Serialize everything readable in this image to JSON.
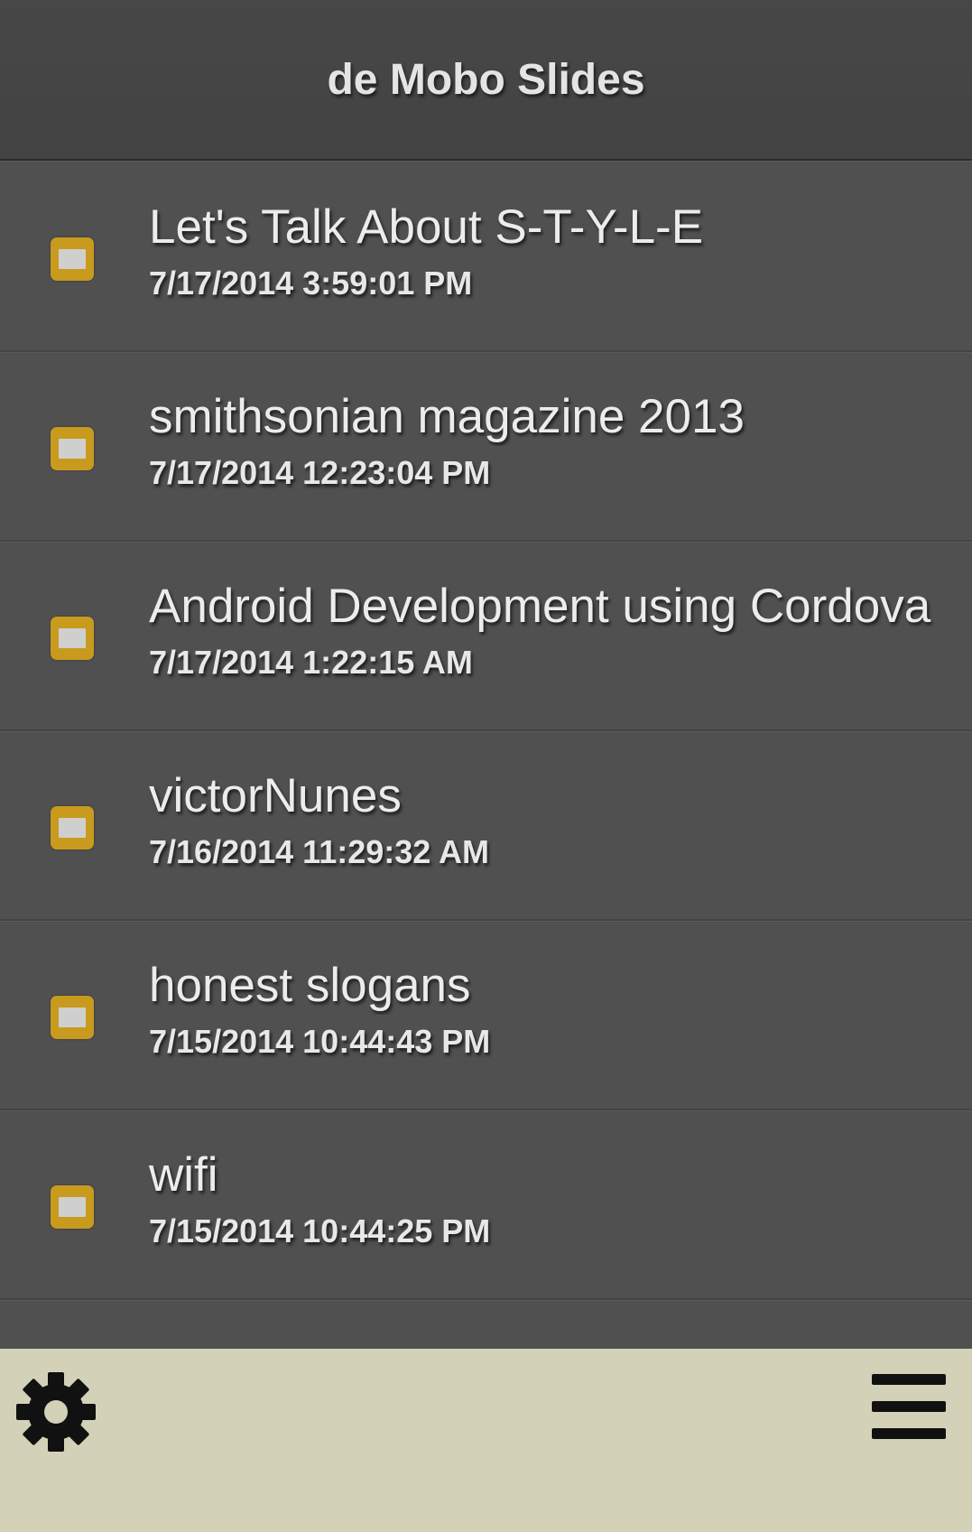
{
  "header": {
    "title": "de Mobo Slides"
  },
  "slides": [
    {
      "title": "Let's Talk About S-T-Y-L-E",
      "date": "7/17/2014 3:59:01 PM"
    },
    {
      "title": "smithsonian magazine 2013",
      "date": "7/17/2014 12:23:04 PM"
    },
    {
      "title": "Android Development using Cordova",
      "date": "7/17/2014 1:22:15 AM"
    },
    {
      "title": "victorNunes",
      "date": "7/16/2014 11:29:32 AM"
    },
    {
      "title": "honest slogans",
      "date": "7/15/2014 10:44:43 PM"
    },
    {
      "title": "wifi",
      "date": "7/15/2014 10:44:25 PM"
    }
  ],
  "icons": {
    "slide": "slide-icon",
    "settings": "gear-icon",
    "menu": "hamburger-menu-icon"
  },
  "colors": {
    "header_bg": "#474747",
    "list_bg": "#505050",
    "footer_bg": "#d3d2b9",
    "slide_icon": "#c89a1e",
    "text": "#ececec"
  }
}
